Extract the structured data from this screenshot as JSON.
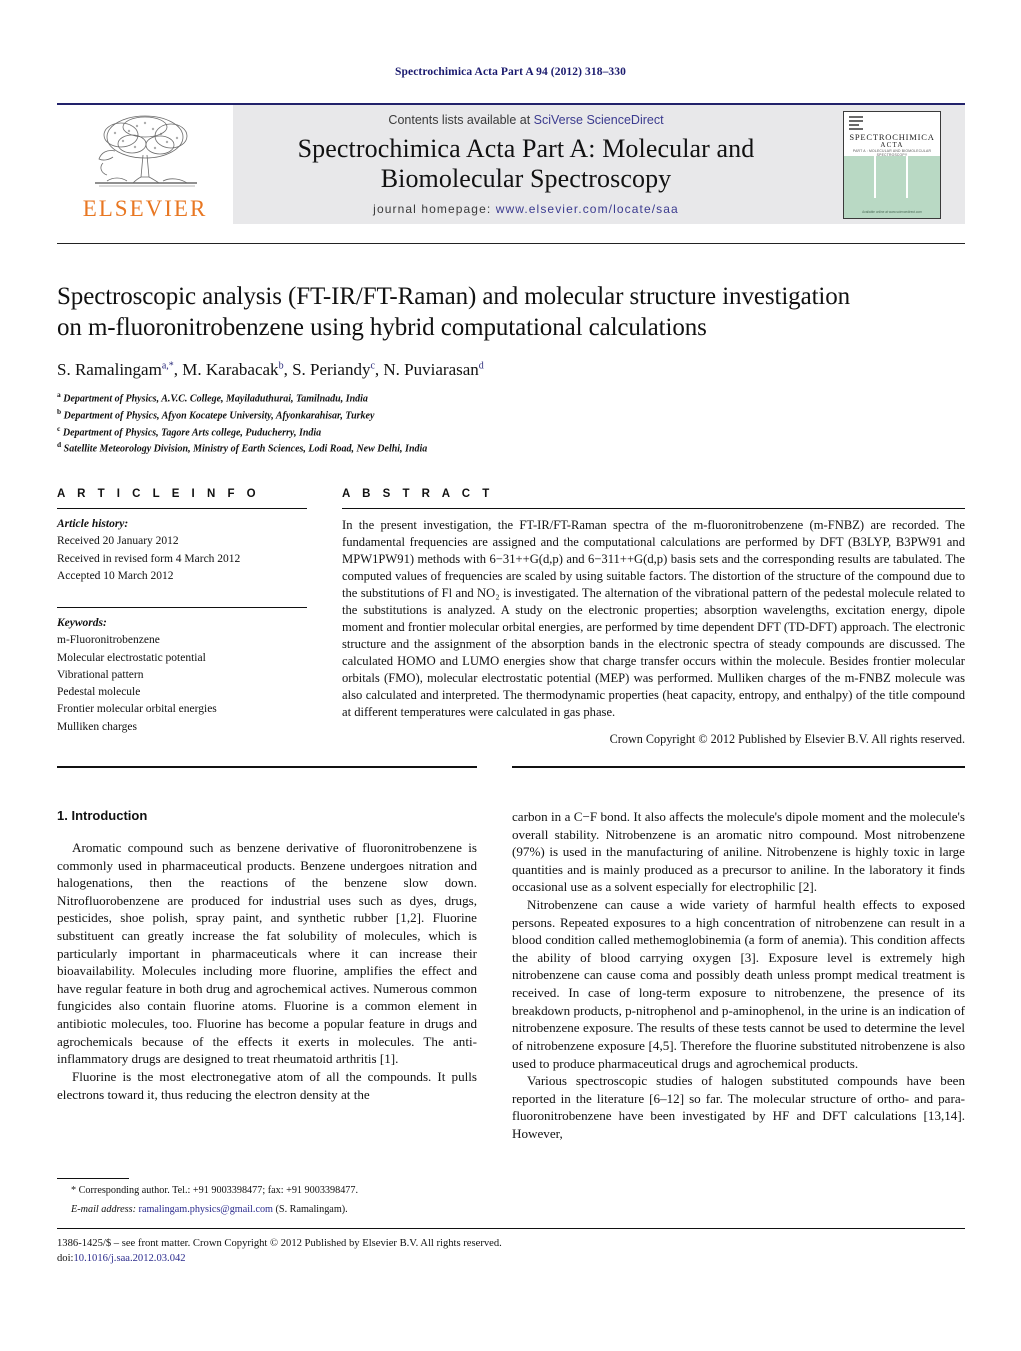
{
  "running_head": "Spectrochimica Acta Part A 94 (2012) 318–330",
  "masthead": {
    "publisher_name": "ELSEVIER",
    "contents_prefix": "Contents lists available at ",
    "contents_link": "SciVerse ScienceDirect",
    "journal_title_line1": "Spectrochimica Acta Part A: Molecular and",
    "journal_title_line2": "Biomolecular Spectroscopy",
    "homepage_prefix": "journal homepage: ",
    "homepage_url": "www.elsevier.com/locate/saa",
    "cover": {
      "line1": "SPECTROCHIMICA",
      "line2": "ACTA",
      "line3": "PART A : MOLECULAR AND BIOMOLECULAR SPECTROSCOPY",
      "footer": "Available online at www.sciencedirect.com"
    }
  },
  "article": {
    "title_line1": "Spectroscopic analysis (FT-IR/FT-Raman) and molecular structure investigation",
    "title_line2": "on m-fluoronitrobenzene using hybrid computational calculations",
    "authors": [
      {
        "name": "S. Ramalingam",
        "marks": "a,*",
        "sep": ", "
      },
      {
        "name": "M. Karabacak",
        "marks": "b",
        "sep": ", "
      },
      {
        "name": "S. Periandy",
        "marks": "c",
        "sep": ", "
      },
      {
        "name": "N. Puviarasan",
        "marks": "d",
        "sep": ""
      }
    ],
    "affiliations": [
      {
        "mark": "a",
        "text": "Department of Physics, A.V.C. College, Mayiladuthurai, Tamilnadu, India"
      },
      {
        "mark": "b",
        "text": "Department of Physics, Afyon Kocatepe University, Afyonkarahisar, Turkey"
      },
      {
        "mark": "c",
        "text": "Department of Physics, Tagore Arts college, Puducherry, India"
      },
      {
        "mark": "d",
        "text": "Satellite Meteorology Division, Ministry of Earth Sciences, Lodi Road, New Delhi, India"
      }
    ]
  },
  "article_info": {
    "heading": "A R T I C L E   I N F O",
    "history_label": "Article history:",
    "history": [
      "Received 20 January 2012",
      "Received in revised form 4 March 2012",
      "Accepted 10 March 2012"
    ],
    "keywords_label": "Keywords:",
    "keywords": [
      "m-Fluoronitrobenzene",
      "Molecular electrostatic potential",
      "Vibrational pattern",
      "Pedestal molecule",
      "Frontier molecular orbital energies",
      "Mulliken charges"
    ]
  },
  "abstract": {
    "heading": "A B S T R A C T",
    "body": "In the present investigation, the FT-IR/FT-Raman spectra of the m-fluoronitrobenzene (m-FNBZ) are recorded. The fundamental frequencies are assigned and the computational calculations are performed by DFT (B3LYP, B3PW91 and MPW1PW91) methods with 6−31++G(d,p) and 6−311++G(d,p) basis sets and the corresponding results are tabulated. The computed values of frequencies are scaled by using suitable factors. The distortion of the structure of the compound due to the substitutions of Fl and NO₂ is investigated. The alternation of the vibrational pattern of the pedestal molecule related to the substitutions is analyzed. A study on the electronic properties; absorption wavelengths, excitation energy, dipole moment and frontier molecular orbital energies, are performed by time dependent DFT (TD-DFT) approach. The electronic structure and the assignment of the absorption bands in the electronic spectra of steady compounds are discussed. The calculated HOMO and LUMO energies show that charge transfer occurs within the molecule. Besides frontier molecular orbitals (FMO), molecular electrostatic potential (MEP) was performed. Mulliken charges of the m-FNBZ molecule was also calculated and interpreted. The thermodynamic properties (heat capacity, entropy, and enthalpy) of the title compound at different temperatures were calculated in gas phase.",
    "copyright": "Crown Copyright © 2012 Published by Elsevier B.V. All rights reserved."
  },
  "introduction": {
    "heading": "1.  Introduction",
    "left_paragraphs": [
      "Aromatic compound such as benzene derivative of fluoronitrobenzene is commonly used in pharmaceutical products. Benzene undergoes nitration and halogenations, then the reactions of the benzene slow down. Nitrofluorobenzene are produced for industrial uses such as dyes, drugs, pesticides, shoe polish, spray paint, and synthetic rubber [1,2]. Fluorine substituent can greatly increase the fat solubility of molecules, which is particularly important in pharmaceuticals where it can increase their bioavailability. Molecules including more fluorine, amplifies the effect and have regular feature in both drug and agrochemical actives. Numerous common fungicides also contain fluorine atoms. Fluorine is a common element in antibiotic molecules, too. Fluorine has become a popular feature in drugs and agrochemicals because of the effects it exerts in molecules. The anti-inflammatory drugs are designed to treat rheumatoid arthritis [1].",
      "Fluorine is the most electronegative atom of all the compounds. It pulls electrons toward it, thus reducing the electron density at the"
    ],
    "right_paragraphs": [
      "carbon in a C−F bond. It also affects the molecule's dipole moment and the molecule's overall stability. Nitrobenzene is an aromatic nitro compound. Most nitrobenzene (97%) is used in the manufacturing of aniline. Nitrobenzene is highly toxic in large quantities and is mainly produced as a precursor to aniline. In the laboratory it finds occasional use as a solvent especially for electrophilic [2].",
      "Nitrobenzene can cause a wide variety of harmful health effects to exposed persons. Repeated exposures to a high concentration of nitrobenzene can result in a blood condition called methemoglobinemia (a form of anemia). This condition affects the ability of blood carrying oxygen [3]. Exposure level is extremely high nitrobenzene can cause coma and possibly death unless prompt medical treatment is received. In case of long-term exposure to nitrobenzene, the presence of its breakdown products, p-nitrophenol and p-aminophenol, in the urine is an indication of nitrobenzene exposure. The results of these tests cannot be used to determine the level of nitrobenzene exposure [4,5]. Therefore the fluorine substituted nitrobenzene is also used to produce pharmaceutical drugs and agrochemical products.",
      "Various spectroscopic studies of halogen substituted compounds have been reported in the literature [6–12] so far. The molecular structure of ortho- and para-fluoronitrobenzene have been investigated by HF and DFT calculations [13,14]. However,"
    ]
  },
  "footnote": {
    "corresponding": "* Corresponding author. Tel.: +91 9003398477; fax: +91 9003398477.",
    "email_label": "E-mail address:",
    "email": "ramalingam.physics@gmail.com",
    "email_suffix": " (S. Ramalingam)."
  },
  "bottom": {
    "line1": "1386-1425/$ – see front matter. Crown Copyright © 2012 Published by Elsevier B.V. All rights reserved.",
    "doi_label": "doi:",
    "doi": "10.1016/j.saa.2012.03.042"
  },
  "colors": {
    "link": "#2a2a8c",
    "running_head": "#1a1a6e",
    "elsevier_orange": "#e87722",
    "masthead_bg": "#e8e8ea",
    "cover_green": "#b9d9c4"
  }
}
